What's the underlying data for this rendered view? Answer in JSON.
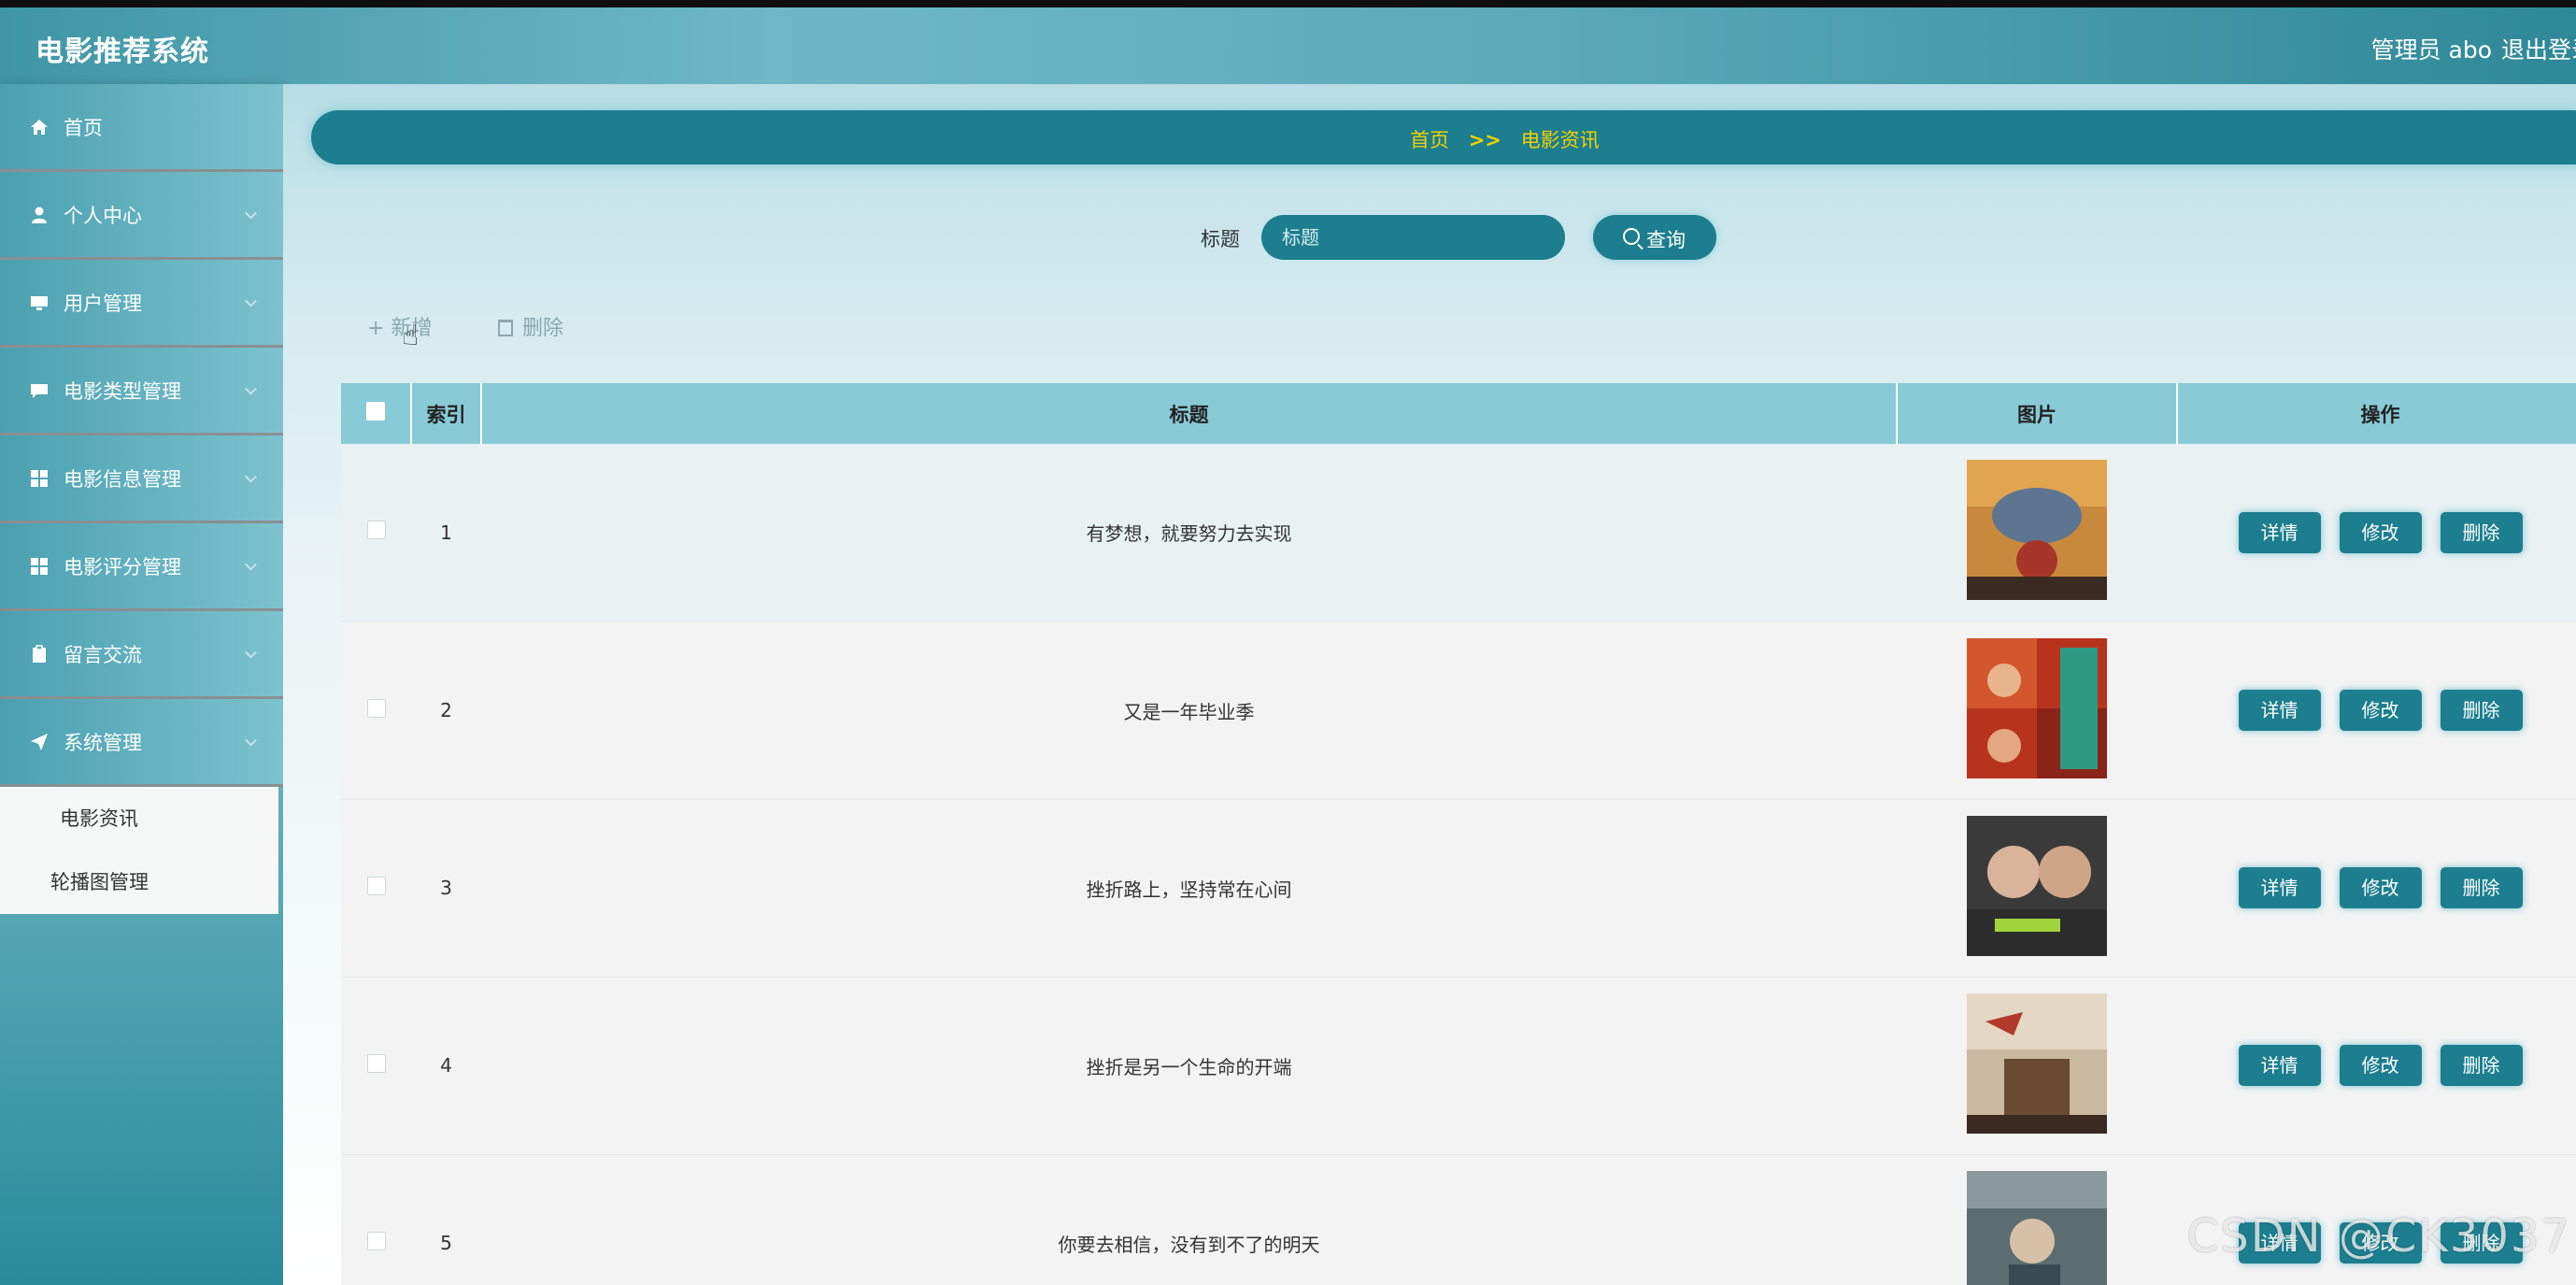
{
  "header": {
    "app_title": "电影推荐系统",
    "admin_label": "管理员 abo",
    "logout_label": "退出登录"
  },
  "sidebar": {
    "items": [
      {
        "label": "首页",
        "icon": "home-icon"
      },
      {
        "label": "个人中心",
        "icon": "user-icon"
      },
      {
        "label": "用户管理",
        "icon": "monitor-icon"
      },
      {
        "label": "电影类型管理",
        "icon": "comment-icon"
      },
      {
        "label": "电影信息管理",
        "icon": "grid-icon"
      },
      {
        "label": "电影评分管理",
        "icon": "grid-icon"
      },
      {
        "label": "留言交流",
        "icon": "clipboard-icon"
      },
      {
        "label": "系统管理",
        "icon": "send-icon"
      }
    ],
    "submenu": [
      "电影资讯",
      "轮播图管理"
    ]
  },
  "breadcrumb": {
    "home": "首页",
    "separator": ">>",
    "current": "电影资讯"
  },
  "search": {
    "label": "标题",
    "placeholder": "标题",
    "button_label": "查询"
  },
  "actions": {
    "add_label": "新增",
    "delete_label": "删除"
  },
  "table": {
    "headers": {
      "index": "索引",
      "title": "标题",
      "image": "图片",
      "ops": "操作"
    },
    "op_labels": {
      "detail": "详情",
      "edit": "修改",
      "delete": "删除"
    },
    "rows": [
      {
        "index": "1",
        "title": "有梦想，就要努力去实现"
      },
      {
        "index": "2",
        "title": "又是一年毕业季"
      },
      {
        "index": "3",
        "title": "挫折路上，坚持常在心间"
      },
      {
        "index": "4",
        "title": "挫折是另一个生命的开端"
      },
      {
        "index": "5",
        "title": "你要去相信，没有到不了的明天"
      }
    ]
  },
  "watermark": "CSDN @CK3037",
  "colors": {
    "primary": "#1c7e8e",
    "breadcrumb_text": "#f3d000",
    "table_header": "#88cad6"
  }
}
